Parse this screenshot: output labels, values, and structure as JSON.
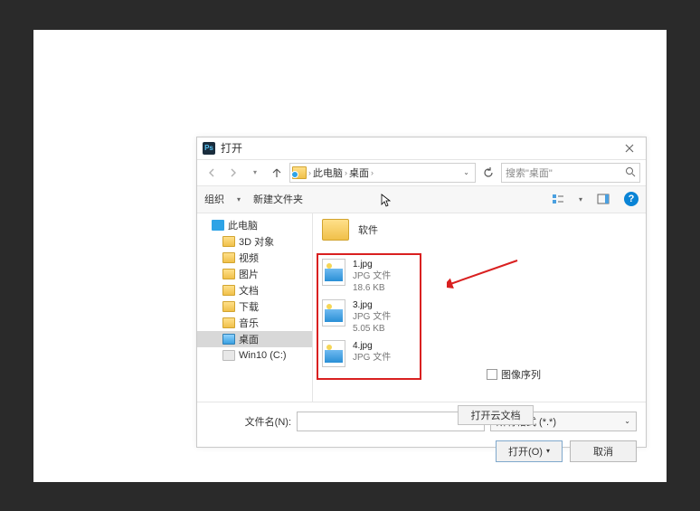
{
  "dialog": {
    "title": "打开",
    "breadcrumb": {
      "pc": "此电脑",
      "desktop": "桌面"
    },
    "search_placeholder": "搜索\"桌面\"",
    "toolbar": {
      "organize": "组织",
      "new_folder": "新建文件夹"
    },
    "folder_label": "软件",
    "files": [
      {
        "name": "1.jpg",
        "type": "JPG 文件",
        "size": "18.6 KB"
      },
      {
        "name": "3.jpg",
        "type": "JPG 文件",
        "size": "5.05 KB"
      },
      {
        "name": "4.jpg",
        "type": "JPG 文件",
        "size": ""
      }
    ],
    "cloud_button": "打开云文档",
    "sequence_label": "图像序列",
    "filename_label": "文件名(N):",
    "filter_label": "所有格式 (*.*)",
    "open_btn": "打开(O)",
    "cancel_btn": "取消"
  },
  "sidebar": [
    {
      "label": "此电脑",
      "icon": "monitor",
      "child": false
    },
    {
      "label": "3D 对象",
      "icon": "fold-y",
      "child": true
    },
    {
      "label": "视频",
      "icon": "fold-y",
      "child": true
    },
    {
      "label": "图片",
      "icon": "fold-y",
      "child": true
    },
    {
      "label": "文档",
      "icon": "fold-y",
      "child": true
    },
    {
      "label": "下载",
      "icon": "fold-y",
      "child": true
    },
    {
      "label": "音乐",
      "icon": "fold-y",
      "child": true
    },
    {
      "label": "桌面",
      "icon": "fold-b",
      "child": true,
      "selected": true
    },
    {
      "label": "Win10 (C:)",
      "icon": "disk",
      "child": true
    }
  ]
}
